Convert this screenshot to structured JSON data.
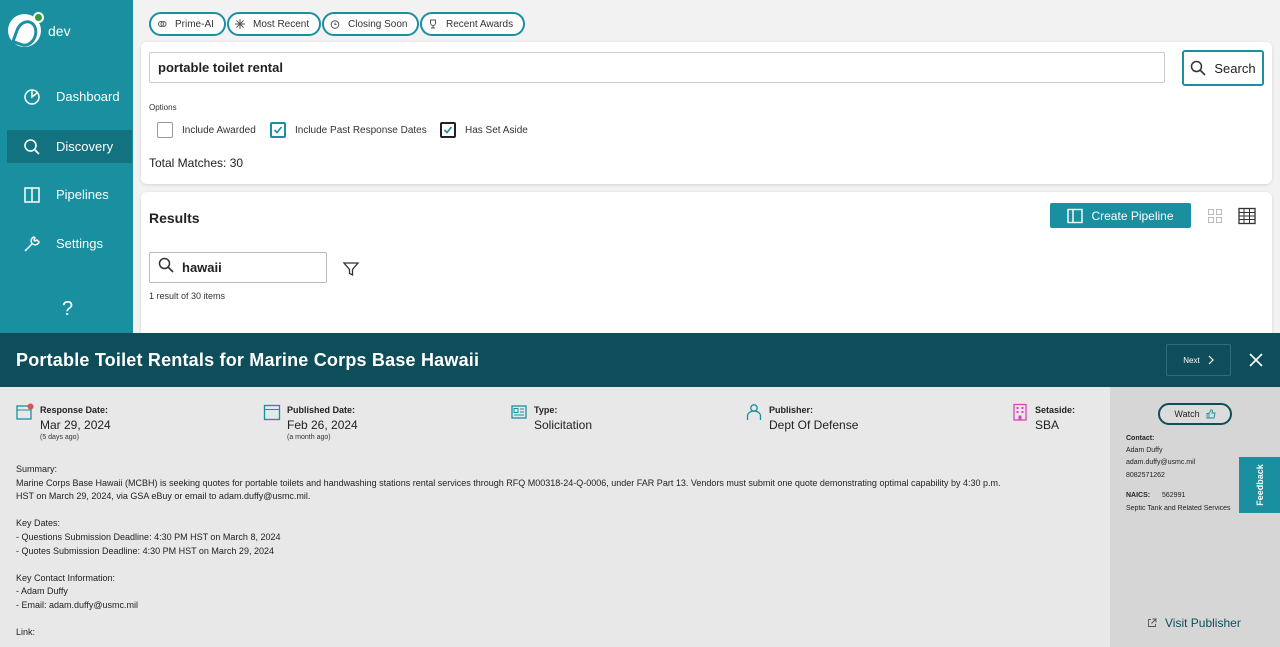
{
  "app": {
    "env": "dev"
  },
  "sidebar": {
    "items": [
      {
        "label": "Dashboard",
        "icon": "dashboard-icon"
      },
      {
        "label": "Discovery",
        "icon": "search-icon",
        "active": true
      },
      {
        "label": "Pipelines",
        "icon": "pipelines-icon"
      },
      {
        "label": "Settings",
        "icon": "wrench-icon"
      }
    ],
    "help": "?"
  },
  "chips": [
    {
      "label": "Prime-AI"
    },
    {
      "label": "Most Recent"
    },
    {
      "label": "Closing Soon"
    },
    {
      "label": "Recent Awards"
    }
  ],
  "search": {
    "value": "portable toilet rental",
    "button": "Search",
    "options_label": "Options",
    "options": [
      {
        "label": "Include Awarded",
        "checked": false
      },
      {
        "label": "Include Past Response Dates",
        "checked": true
      },
      {
        "label": "Has Set Aside",
        "checked": true
      }
    ],
    "total": "Total Matches: 30"
  },
  "results": {
    "title": "Results",
    "create_pipeline": "Create Pipeline",
    "filter_value": "hawaii",
    "count": "1 result of 30 items"
  },
  "detail": {
    "title": "Portable Toilet Rentals for Marine Corps Base Hawaii",
    "next": "Next",
    "meta": [
      {
        "label": "Response Date:",
        "value": "Mar 29, 2024",
        "sub": "(5 days ago)"
      },
      {
        "label": "Published Date:",
        "value": "Feb 26, 2024",
        "sub": "(a month ago)"
      },
      {
        "label": "Type:",
        "value": "Solicitation",
        "sub": ""
      },
      {
        "label": "Publisher:",
        "value": "Dept Of Defense",
        "sub": ""
      },
      {
        "label": "Setaside:",
        "value": "SBA",
        "sub": ""
      }
    ],
    "summary": "Summary:\nMarine Corps Base Hawaii (MCBH) is seeking quotes for portable toilets and handwashing stations rental services through RFQ M00318-24-Q-0006, under FAR Part 13. Vendors must submit one quote demonstrating optimal capability by 4:30 p.m.\nHST on March 29, 2024, via GSA eBuy or email to adam.duffy@usmc.mil.\n\nKey Dates:\n- Questions Submission Deadline: 4:30 PM HST on March 8, 2024\n- Quotes Submission Deadline: 4:30 PM HST on March 29, 2024\n\nKey Contact Information:\n- Adam Duffy\n- Email: adam.duffy@usmc.mil\n\nLink:",
    "side": {
      "watch": "Watch",
      "contact_label": "Contact:",
      "contact_name": "Adam Duffy",
      "contact_email": "adam.duffy@usmc.mil",
      "contact_phone": "8082571262",
      "naics_label": "NAICS:",
      "naics_code": "562991",
      "naics_desc": "Septic Tank and Related Services",
      "visit": "Visit Publisher"
    }
  },
  "feedback": "Feedback",
  "colors": {
    "primary": "#1a8fa0",
    "dark": "#0d4e5a",
    "active_nav": "#12727f",
    "calendar_red": "#d9534f",
    "setaside_pink": "#e040c0"
  }
}
